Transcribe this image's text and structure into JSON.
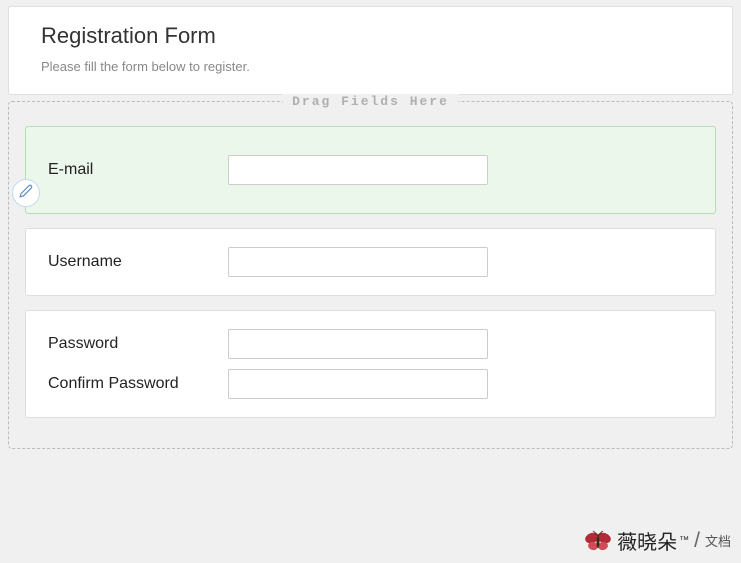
{
  "header": {
    "title": "Registration Form",
    "subtitle": "Please fill the form below to register."
  },
  "dropzone": {
    "label": "Drag Fields Here"
  },
  "cards": [
    {
      "selected": true,
      "fields": [
        {
          "label": "E-mail",
          "value": ""
        }
      ]
    },
    {
      "selected": false,
      "fields": [
        {
          "label": "Username",
          "value": ""
        }
      ]
    },
    {
      "selected": false,
      "fields": [
        {
          "label": "Password",
          "value": ""
        },
        {
          "label": "Confirm Password",
          "value": ""
        }
      ]
    }
  ],
  "watermark": {
    "name": "薇晓朵",
    "tm": "™",
    "slash": "/",
    "doc": "文档"
  }
}
